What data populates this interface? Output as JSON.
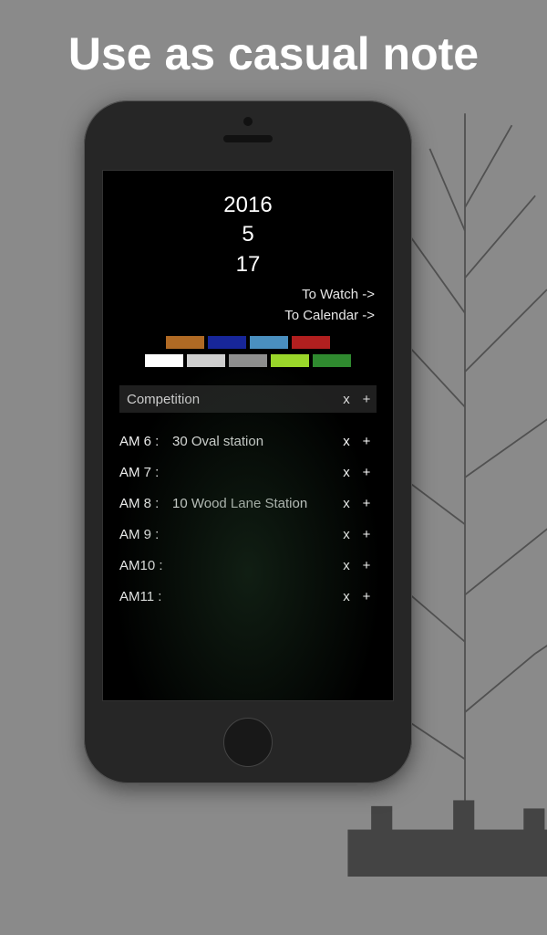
{
  "headline": "Use as casual note",
  "date": {
    "year": "2016",
    "month": "5",
    "day": "17"
  },
  "nav": {
    "watch": "To Watch ->",
    "calendar": "To Calendar ->"
  },
  "palette": {
    "row1": [
      "#b06a24",
      "#17269a",
      "#4a8fbf",
      "#b11f1f"
    ],
    "row2": [
      "#ffffff",
      "#cfcfcf",
      "#8f8f8f",
      "#9ad62a",
      "#2f8a2f"
    ]
  },
  "note": {
    "title": "Competition",
    "x": "x",
    "plus": "+"
  },
  "slots": [
    {
      "time": "AM 6 :",
      "value": " 30 Oval station"
    },
    {
      "time": "AM 7 :",
      "value": ""
    },
    {
      "time": "AM 8 :",
      "value": " 10 Wood Lane Station"
    },
    {
      "time": "AM 9 :",
      "value": ""
    },
    {
      "time": "AM10 :",
      "value": ""
    },
    {
      "time": "AM11 :",
      "value": ""
    }
  ],
  "controls": {
    "x": "x",
    "plus": "+"
  }
}
